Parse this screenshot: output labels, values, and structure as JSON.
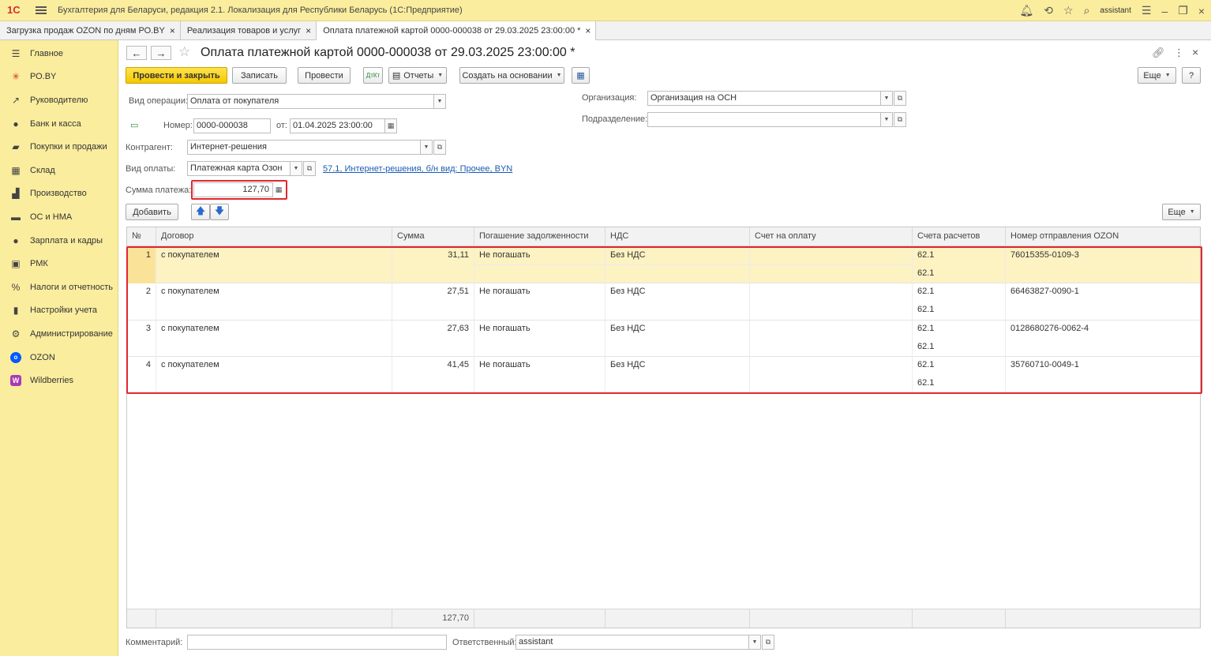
{
  "app": {
    "logo": "1С",
    "title": "Бухгалтерия для Беларуси, редакция 2.1. Локализация для Республики Беларусь   (1С:Предприятие)",
    "user": "assistant"
  },
  "tabs": [
    {
      "label": "Загрузка продаж OZON по дням РО.BY"
    },
    {
      "label": "Реализация товаров и услуг"
    },
    {
      "label": "Оплата платежной картой 0000-000038 от 29.03.2025 23:00:00 *"
    }
  ],
  "sidebar": {
    "items": [
      {
        "label": "Главное",
        "icon": "menu-icon"
      },
      {
        "label": "РО.BY",
        "icon": "star-burst-icon"
      },
      {
        "label": "Руководителю",
        "icon": "trend-icon"
      },
      {
        "label": "Банк и касса",
        "icon": "coin-icon"
      },
      {
        "label": "Покупки и продажи",
        "icon": "cart-icon"
      },
      {
        "label": "Склад",
        "icon": "warehouse-icon"
      },
      {
        "label": "Производство",
        "icon": "factory-icon"
      },
      {
        "label": "ОС и НМА",
        "icon": "truck-icon"
      },
      {
        "label": "Зарплата и кадры",
        "icon": "person-icon"
      },
      {
        "label": "РМК",
        "icon": "register-icon"
      },
      {
        "label": "Налоги и отчетность",
        "icon": "percent-icon"
      },
      {
        "label": "Настройки учета",
        "icon": "book-icon"
      },
      {
        "label": "Администрирование",
        "icon": "gear-icon"
      },
      {
        "label": "OZON",
        "icon": "ozon-icon"
      },
      {
        "label": "Wildberries",
        "icon": "wildberries-icon"
      }
    ]
  },
  "document": {
    "title": "Оплата платежной картой 0000-000038 от 29.03.2025 23:00:00 *",
    "toolbar": {
      "post_close": "Провести и закрыть",
      "save": "Записать",
      "post": "Провести",
      "reports": "Отчеты",
      "create_based": "Создать на основании",
      "more": "Еще",
      "help": "?"
    },
    "fields": {
      "operation_label": "Вид операции:",
      "operation_value": "Оплата от покупателя",
      "number_label": "Номер:",
      "number_value": "0000-000038",
      "from_label": "от:",
      "date_value": "01.04.2025 23:00:00",
      "counterparty_label": "Контрагент:",
      "counterparty_value": "Интернет-решения",
      "payment_type_label": "Вид оплаты:",
      "payment_type_value": "Платежная карта Озон",
      "payment_link": "57.1, Интернет-решения, б/н вид: Прочее, BYN",
      "amount_label": "Сумма платежа:",
      "amount_value": "127,70",
      "organization_label": "Организация:",
      "organization_value": "Организация на ОСН",
      "division_label": "Подразделение:",
      "division_value": "",
      "comment_label": "Комментарий:",
      "comment_value": "",
      "responsible_label": "Ответственный:",
      "responsible_value": "assistant"
    },
    "table": {
      "add": "Добавить",
      "more": "Еще",
      "columns": [
        "№",
        "Договор",
        "Сумма",
        "Погашение задолженности",
        "НДС",
        "Счет на оплату",
        "Счета расчетов",
        "Номер отправления OZON"
      ],
      "rows": [
        {
          "n": "1",
          "contract": "с покупателем",
          "sum": "31,11",
          "repay": "Не погашать",
          "vat": "Без НДС",
          "invoice": "",
          "acc1": "62.1",
          "acc2": "62.1",
          "ozon": "76015355-0109-3"
        },
        {
          "n": "2",
          "contract": "с покупателем",
          "sum": "27,51",
          "repay": "Не погашать",
          "vat": "Без НДС",
          "invoice": "",
          "acc1": "62.1",
          "acc2": "62.1",
          "ozon": "66463827-0090-1"
        },
        {
          "n": "3",
          "contract": "с покупателем",
          "sum": "27,63",
          "repay": "Не погашать",
          "vat": "Без НДС",
          "invoice": "",
          "acc1": "62.1",
          "acc2": "62.1",
          "ozon": "0128680276-0062-4"
        },
        {
          "n": "4",
          "contract": "с покупателем",
          "sum": "41,45",
          "repay": "Не погашать",
          "vat": "Без НДС",
          "invoice": "",
          "acc1": "62.1",
          "acc2": "62.1",
          "ozon": "35760710-0049-1"
        }
      ],
      "total": "127,70"
    }
  },
  "colors": {
    "accent_yellow": "#fbed9e",
    "primary_button": "#f5c800",
    "highlight_red": "#e0282f",
    "link": "#1a5bb3"
  }
}
